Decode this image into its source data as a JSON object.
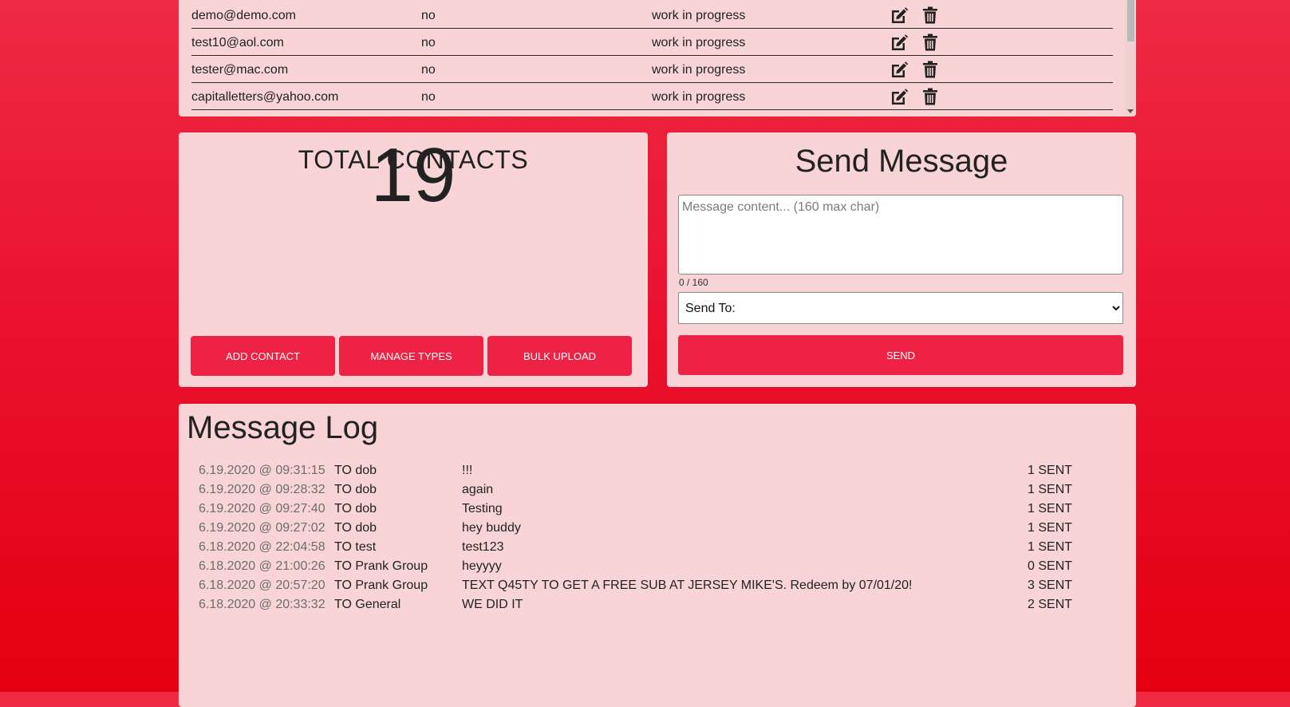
{
  "contacts": {
    "rows": [
      {
        "email": "demo@demo.com",
        "flag": "no",
        "status": "work in progress"
      },
      {
        "email": "test10@aol.com",
        "flag": "no",
        "status": "work in progress"
      },
      {
        "email": "tester@mac.com",
        "flag": "no",
        "status": "work in progress"
      },
      {
        "email": "capitalletters@yahoo.com",
        "flag": "no",
        "status": "work in progress"
      }
    ],
    "row_icons": [
      "edit-icon",
      "trash-icon"
    ]
  },
  "total": {
    "title": "TOTAL CONTACTS",
    "count": "19",
    "buttons": {
      "add": "ADD CONTACT",
      "types": "MANAGE TYPES",
      "bulk": "BULK UPLOAD"
    }
  },
  "send": {
    "title": "Send Message",
    "placeholder": "Message content... (160 max char)",
    "char_count": "0 / 160",
    "send_to": "Send To:",
    "button": "SEND"
  },
  "log": {
    "title": "Message Log",
    "rows": [
      {
        "time": "6.19.2020 @ 09:31:15",
        "to": "TO dob",
        "message": "!!!",
        "sent": "1 SENT"
      },
      {
        "time": "6.19.2020 @ 09:28:32",
        "to": "TO dob",
        "message": "again",
        "sent": "1 SENT"
      },
      {
        "time": "6.19.2020 @ 09:27:40",
        "to": "TO dob",
        "message": "Testing",
        "sent": "1 SENT"
      },
      {
        "time": "6.19.2020 @ 09:27:02",
        "to": "TO dob",
        "message": "hey buddy",
        "sent": "1 SENT"
      },
      {
        "time": "6.18.2020 @ 22:04:58",
        "to": "TO test",
        "message": "test123",
        "sent": "1 SENT"
      },
      {
        "time": "6.18.2020 @ 21:00:26",
        "to": "TO Prank Group",
        "message": "heyyyy",
        "sent": "0 SENT"
      },
      {
        "time": "6.18.2020 @ 20:57:20",
        "to": "TO Prank Group",
        "message": "TEXT Q45TY TO GET A FREE SUB AT JERSEY MIKE'S. Redeem by 07/01/20!",
        "sent": "3 SENT"
      },
      {
        "time": "6.18.2020 @ 20:33:32",
        "to": "TO General",
        "message": "WE DID IT",
        "sent": "2 SENT"
      }
    ]
  },
  "colors": {
    "accent": "#ee2245",
    "card": "#f9d4d6",
    "background": "#e40010"
  }
}
